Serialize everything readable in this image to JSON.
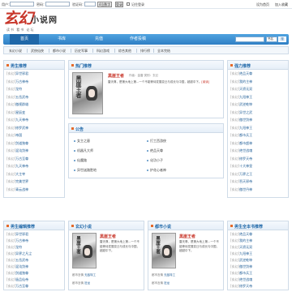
{
  "topbar": {
    "user_label": "用户：",
    "pass_label": "密码：",
    "code_label": "验证码：",
    "code_value": "",
    "code_image": "4位数字",
    "remember_label": "记住登录",
    "login_btn": "登录",
    "links": [
      "设为首页",
      "加入收藏"
    ]
  },
  "logo": {
    "mark": "玄幻",
    "text": "小说网",
    "sub": "读书 看书 论坛"
  },
  "nav": {
    "items": [
      "首页",
      "书库",
      "充值",
      "作者投稿"
    ],
    "search_placeholder": "",
    "search_type": "书名",
    "search_button": "搜"
  },
  "subnav": {
    "items": [
      "玄幻小说",
      "武侠仙侠",
      "都市小说",
      "历史军事",
      "科幻游戏",
      "综合其他",
      "排行榜",
      "全本完结"
    ]
  },
  "left_top": {
    "title": "男生推荐",
    "items": [
      {
        "tag": "[玄幻]",
        "name": "异世邪君"
      },
      {
        "tag": "[玄幻]",
        "name": "万古神帝"
      },
      {
        "tag": "[玄幻]",
        "name": "龙符"
      },
      {
        "tag": "[玄幻]",
        "name": "五岳武帝"
      },
      {
        "tag": "[玄幻]",
        "name": "傲视群雄"
      },
      {
        "tag": "[玄幻]",
        "name": "星辰变"
      },
      {
        "tag": "[玄幻]",
        "name": "九天神帝"
      },
      {
        "tag": "[玄幻]",
        "name": "修罗武神"
      },
      {
        "tag": "[玄幻]",
        "name": "帝国"
      },
      {
        "tag": "[玄幻]",
        "name": "剑道独尊"
      },
      {
        "tag": "[玄幻]",
        "name": "混沌剑神"
      },
      {
        "tag": "[玄幻]",
        "name": "万古至尊"
      },
      {
        "tag": "[玄幻]",
        "name": "九天神帝"
      },
      {
        "tag": "[玄幻]",
        "name": "大主宰"
      },
      {
        "tag": "[玄幻]",
        "name": "完美世界"
      },
      {
        "tag": "[玄幻]",
        "name": "青云战神"
      }
    ]
  },
  "left_bottom": {
    "title": "男生编辑推荐",
    "items": [
      {
        "tag": "[玄幻]",
        "name": "异世邪君"
      },
      {
        "tag": "[玄幻]",
        "name": "万古神帝"
      },
      {
        "tag": "[玄幻]",
        "name": "龙符"
      },
      {
        "tag": "[玄幻]",
        "name": "异界之凡尘"
      },
      {
        "tag": "[玄幻]",
        "name": "五岳武帝"
      },
      {
        "tag": "[玄幻]",
        "name": "混沌剑神"
      },
      {
        "tag": "[玄幻]",
        "name": "剑道独尊"
      },
      {
        "tag": "[玄幻]",
        "name": "极品仙帝"
      },
      {
        "tag": "[玄幻]",
        "name": "万古至尊"
      }
    ]
  },
  "hot": {
    "title": "热门推荐",
    "book_title": "黑崖王者",
    "author_label": "作者：",
    "author": "金雷",
    "category_label": "类别：",
    "category": "玄幻",
    "desc": "雷天尊，是第大地上第...一个不能等待发展变迁与成长与中国，超越中下。",
    "more": "[阅读]"
  },
  "notice": {
    "title": "公告",
    "items": [
      "女主之墓",
      "打工西游侠",
      "机器凡大师",
      "绝品天尊",
      "仙魔路",
      "化功小子",
      "异世迷路胜地",
      "护花心者神"
    ]
  },
  "right_top": {
    "title": "强力推荐",
    "items": [
      {
        "tag": "[玄幻]",
        "name": "绝品天尊"
      },
      {
        "tag": "[玄幻]",
        "name": "我的主神"
      },
      {
        "tag": "[玄幻]",
        "name": "天骄无双"
      },
      {
        "tag": "[玄幻]",
        "name": "九阳神王"
      },
      {
        "tag": "[玄幻]",
        "name": "武逆乾坤"
      },
      {
        "tag": "[玄幻]",
        "name": "异世之武"
      },
      {
        "tag": "[玄幻]",
        "name": "傲世剑神"
      },
      {
        "tag": "[玄幻]",
        "name": "九阳神王"
      },
      {
        "tag": "[玄幻]",
        "name": "都市兵王"
      },
      {
        "tag": "[玄幻]",
        "name": "都市超神"
      },
      {
        "tag": "[玄幻]",
        "name": "绝世战魂"
      },
      {
        "tag": "[玄幻]",
        "name": "修罗天帝"
      },
      {
        "tag": "[玄幻]",
        "name": "十大神皇"
      },
      {
        "tag": "[玄幻]",
        "name": "万界之王"
      },
      {
        "tag": "[玄幻]",
        "name": "吞天邪帝"
      },
      {
        "tag": "[玄幻]",
        "name": "傲世丹神"
      }
    ]
  },
  "right_bottom": {
    "title": "男生全本书推荐",
    "items": [
      {
        "tag": "[玄幻]",
        "name": "绝品天尊"
      },
      {
        "tag": "[玄幻]",
        "name": "我的主神"
      },
      {
        "tag": "[玄幻]",
        "name": "天骄无双"
      },
      {
        "tag": "[玄幻]",
        "name": "九阳神王"
      },
      {
        "tag": "[玄幻]",
        "name": "武逆乾坤"
      },
      {
        "tag": "[玄幻]",
        "name": "傲世剑神"
      },
      {
        "tag": "[玄幻]",
        "name": "都市兵王"
      },
      {
        "tag": "[玄幻]",
        "name": "绝世战魂"
      },
      {
        "tag": "[玄幻]",
        "name": "修罗天帝"
      }
    ]
  },
  "fantasy": {
    "title": "玄幻小说",
    "book_title": "黑崖王者",
    "desc": "雷天尊，是第大地上第...一个不能等待发展变迁与成长与中国，超越中下。",
    "extra1_label": "都市言情",
    "extra1_name": "无敌特工",
    "extra2_label": "都市言情",
    "extra2_name": "狂龙"
  },
  "urban": {
    "title": "都市小说",
    "book_title": "黑崖王者",
    "desc": "雷天尊，是第大地上第...一个不能等待发展变迁与成长与中国，超越中下。",
    "extra1_label": "都市言情",
    "extra1_name": "无敌特工",
    "extra2_label": "都市言情",
    "extra2_name": "狂龙"
  }
}
